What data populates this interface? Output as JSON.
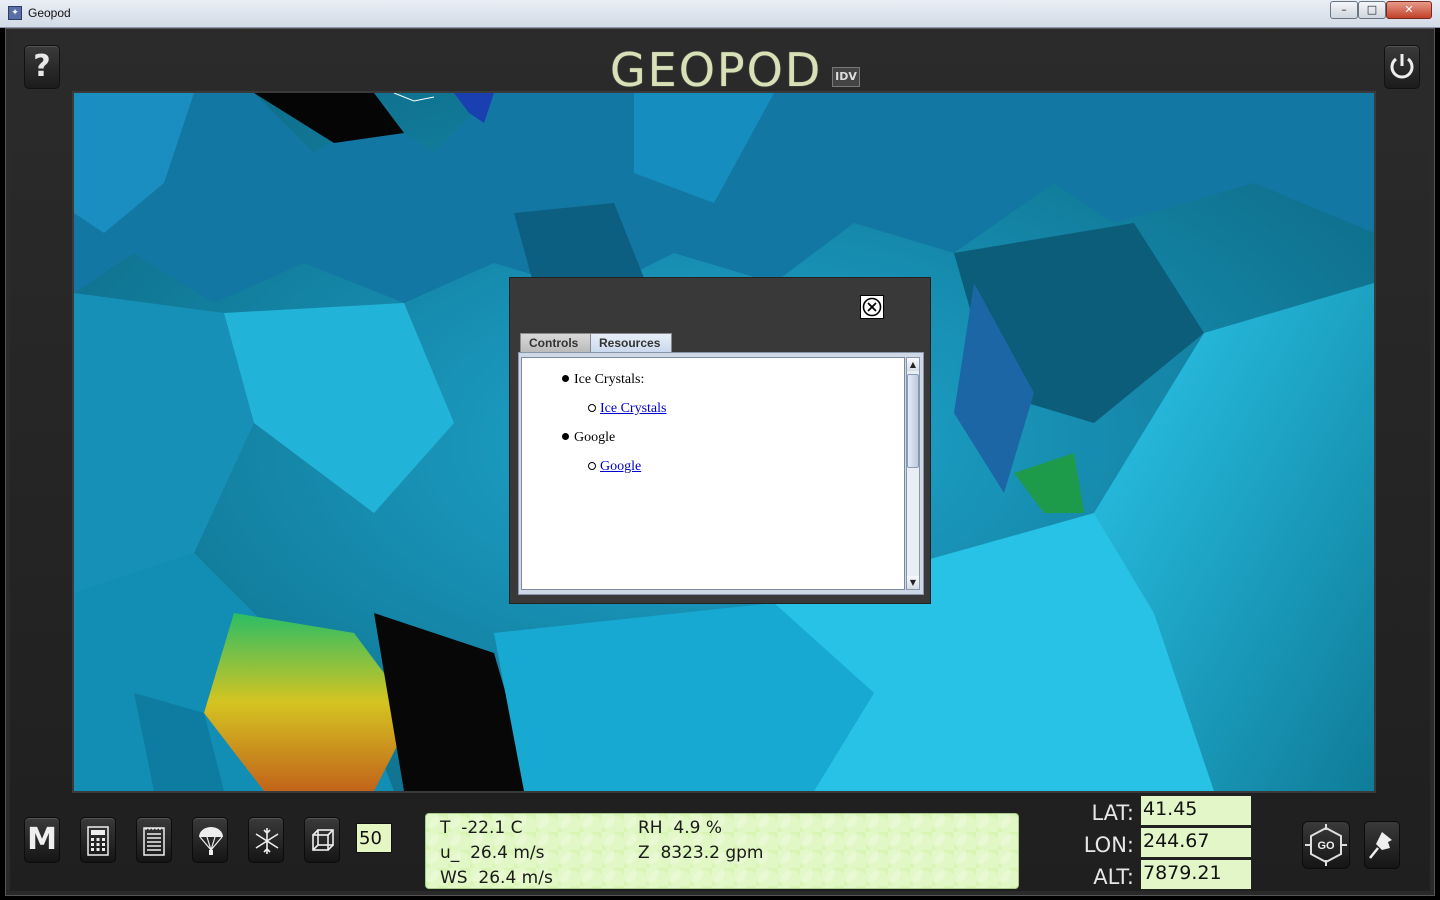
{
  "window": {
    "title": "Geopod",
    "minimize": "–",
    "maximize": "□",
    "close": "✕"
  },
  "header": {
    "logo_text": "GEOPOD",
    "logo_badge": "IDV",
    "help_label": "?",
    "power_icon": "power-icon"
  },
  "dialog": {
    "close_icon": "close-circle-icon",
    "tabs": [
      {
        "label": "Controls",
        "active": false
      },
      {
        "label": "Resources",
        "active": true
      }
    ],
    "resources": [
      {
        "heading": "Ice Crystals:",
        "link": "Ice Crystals"
      },
      {
        "heading": "Google",
        "link": "Google "
      }
    ]
  },
  "toolbar": {
    "menu_label": "M",
    "icons": [
      "calculator-icon",
      "notepad-icon",
      "parachute-icon",
      "snowflake-icon",
      "cube-icon"
    ],
    "number_value": "50"
  },
  "readout": {
    "T": "T  -22.1 C",
    "RH": "RH  4.9 %",
    "u": "u_  26.4 m/s",
    "Z": "Z  8323.2 gpm",
    "WS": "WS  26.4 m/s"
  },
  "coords": {
    "lat_label": "LAT:",
    "lat_value": "41.45",
    "lon_label": "LON:",
    "lon_value": "244.67",
    "alt_label": "ALT:",
    "alt_value": "7879.21"
  },
  "actions": {
    "go_label": "GO",
    "pin_icon": "pushpin-icon"
  },
  "colors": {
    "readout_bg": "#d9f5b6",
    "field_bg": "#e3f6c7",
    "logo": "#d8e0b8",
    "scene_cyan": "#1fb3d9"
  }
}
